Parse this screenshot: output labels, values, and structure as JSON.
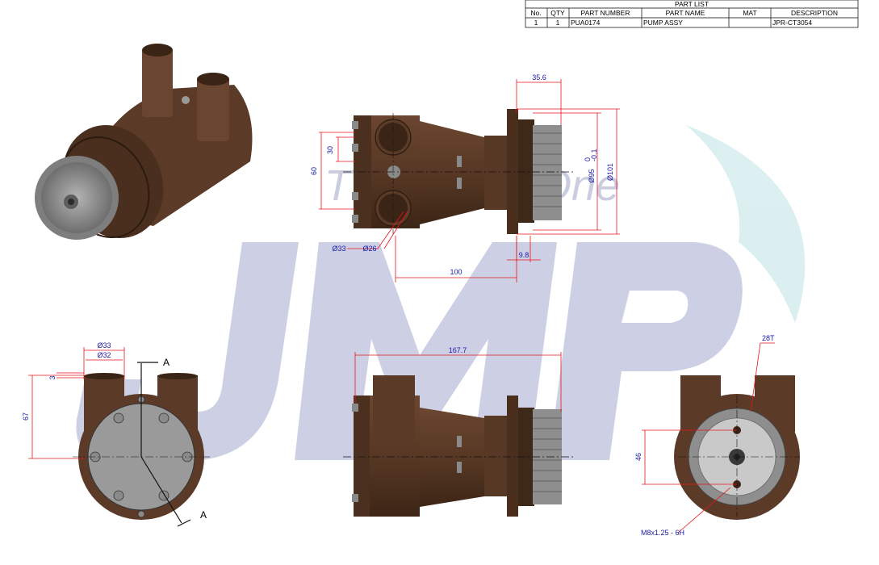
{
  "watermark": {
    "brand": "JMP",
    "tagline": "The Pump One"
  },
  "part_list": {
    "title": "PART LIST",
    "columns": [
      "No.",
      "QTY",
      "PART NUMBER",
      "PART NAME",
      "MAT",
      "DESCRIPTION"
    ],
    "rows": [
      [
        "1",
        "1",
        "PUA0174",
        "PUMP ASSY",
        "",
        "JPR-CT3054"
      ]
    ]
  },
  "side_view_dims": {
    "top_width": "35.6",
    "port_spacing": "30",
    "port_height": "60",
    "inner_dia": "Ø95",
    "inner_dia_tol_upper": "0",
    "inner_dia_tol_lower": "-0.1",
    "outer_dia": "Ø101",
    "port_od": "Ø33",
    "port_id": "Ø26",
    "flange_thickness": "9.8",
    "body_length": "100"
  },
  "front_view_dims": {
    "port_od": "Ø33",
    "port_id": "Ø32",
    "wall": "3",
    "height": "67",
    "section_top": "A",
    "section_bottom": "A"
  },
  "bottom_view_dims": {
    "overall_length": "167.7"
  },
  "rear_view_dims": {
    "gear_teeth": "28T",
    "hole_spacing": "46",
    "thread": "M8x1.25 - 6H"
  },
  "colors": {
    "body": "#5b3b27",
    "body_dark": "#3e2818",
    "gear": "#8e8e8e",
    "dim_line": "#e8141c",
    "dim_text": "#1a1aa6",
    "watermark_blue": "#c8cbe2",
    "watermark_cyan": "#d8eef0"
  }
}
